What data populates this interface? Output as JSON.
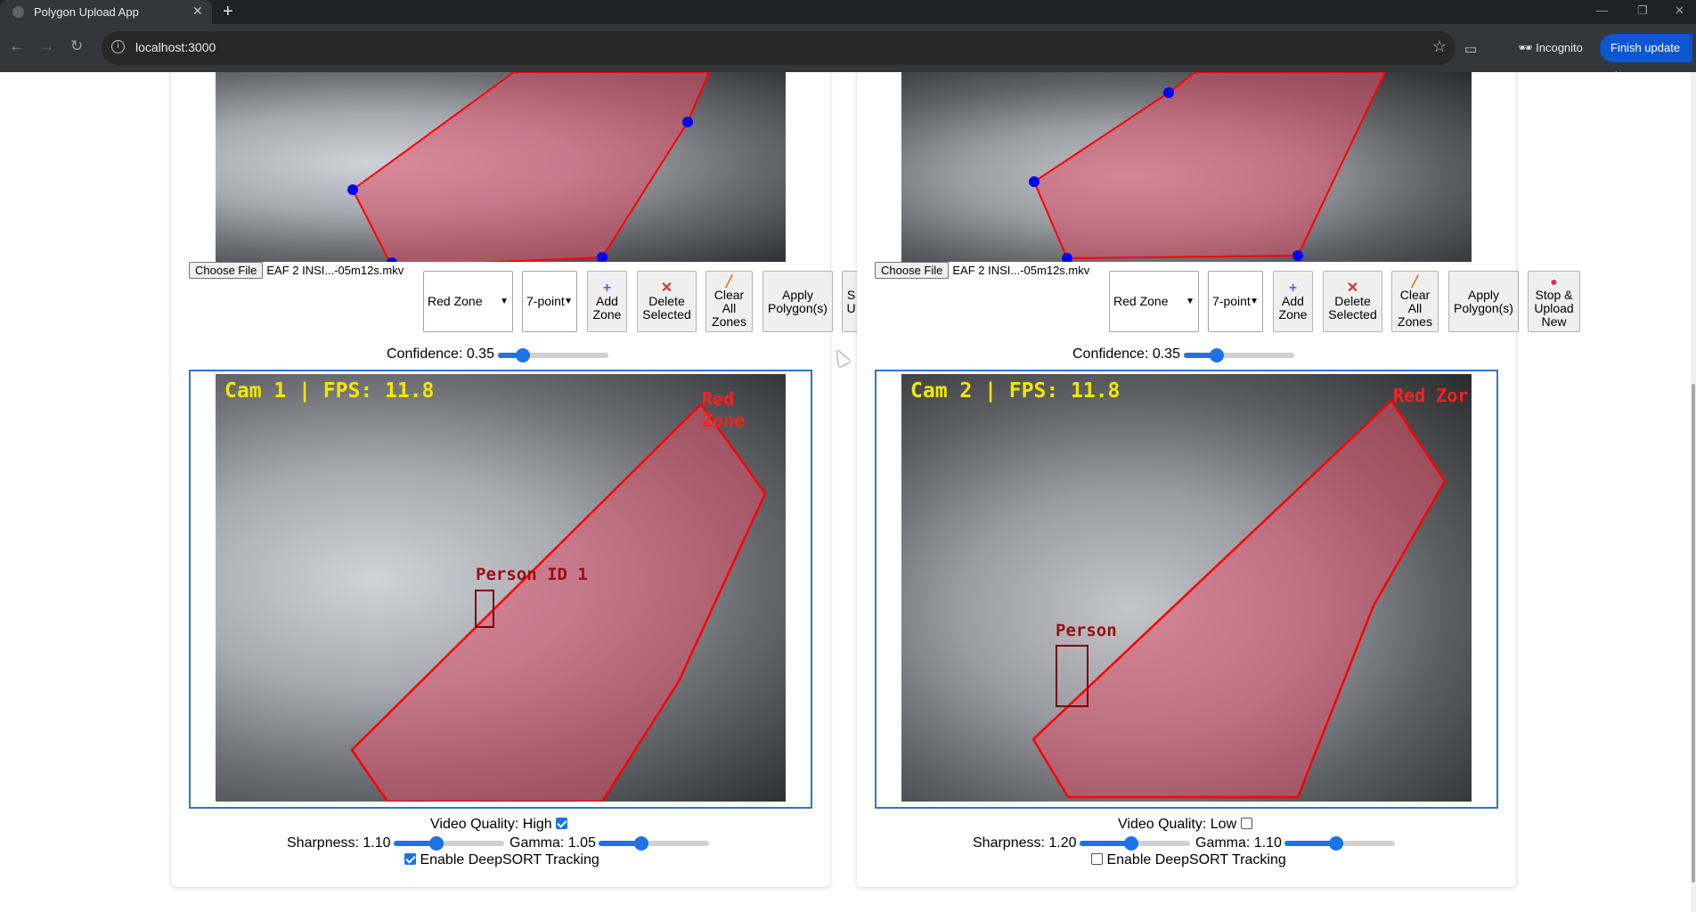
{
  "browser": {
    "tab_title": "Polygon Upload App",
    "tab_close": "✕",
    "new_tab": "+",
    "url": "localhost:3000",
    "incognito_label": "Incognito",
    "update_label": "Finish update"
  },
  "cameras": [
    {
      "file_button": "Choose File",
      "file_name": "EAF 2 INSI...-05m12s.mkv",
      "zone_select": "Red Zone",
      "point_select": "7-point",
      "add_zone": "Add Zone",
      "delete_selected": "Delete Selected",
      "clear_all": "Clear All Zones",
      "apply": "Apply Polygon(s)",
      "stop_upload": "S U",
      "confidence_label": "Confidence: 0.35",
      "confidence_value": 0.35,
      "hud": "Cam 1 | FPS: 11.8",
      "zone_tag": "Red Zone",
      "person_tag": "Person ID 1",
      "video_quality_label": "Video Quality: High",
      "video_quality_checked": true,
      "sharpness_label": "Sharpness: 1.10",
      "sharpness_value": 1.1,
      "gamma_label": "Gamma: 1.05",
      "gamma_value": 1.05,
      "deepsort_label": "Enable DeepSORT Tracking",
      "deepsort_checked": true
    },
    {
      "file_button": "Choose File",
      "file_name": "EAF 2 INSI...-05m12s.mkv",
      "zone_select": "Red Zone",
      "point_select": "7-point",
      "add_zone": "Add Zone",
      "delete_selected": "Delete Selected",
      "clear_all": "Clear All Zones",
      "apply": "Apply Polygon(s)",
      "stop_upload": "Stop & Upload New",
      "confidence_label": "Confidence: 0.35",
      "confidence_value": 0.35,
      "hud": "Cam 2 | FPS: 11.8",
      "zone_tag": "Red Zor",
      "person_tag": "Person",
      "video_quality_label": "Video Quality: Low",
      "video_quality_checked": false,
      "sharpness_label": "Sharpness: 1.20",
      "sharpness_value": 1.2,
      "gamma_label": "Gamma: 1.10",
      "gamma_value": 1.1,
      "deepsort_label": "Enable DeepSORT Tracking",
      "deepsort_checked": false
    }
  ],
  "colors": {
    "zone_fill": "#e0506a",
    "zone_stroke": "#ff0000",
    "vertex": "#0000ff",
    "hud": "#f3e600",
    "accent": "#1a73e8",
    "frame_border": "#2f78c4"
  },
  "icons": {
    "add": "plus-icon",
    "delete": "x-icon",
    "clear": "brush-icon",
    "stop": "record-dot-icon"
  }
}
